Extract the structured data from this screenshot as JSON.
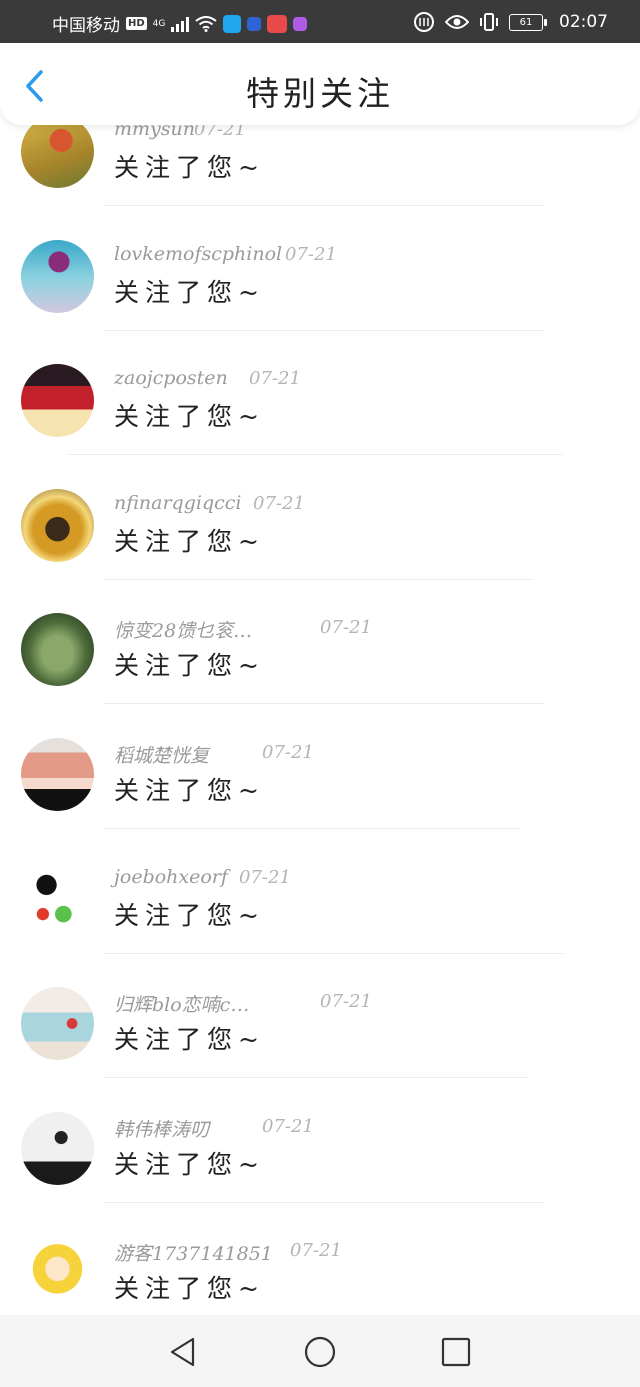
{
  "status_bar": {
    "carrier": "中国移动",
    "hd": "HD",
    "network": "4G",
    "battery": "61",
    "time": "02:07"
  },
  "header": {
    "title": "特别关注",
    "back_icon": "chevron-left-icon"
  },
  "colors": {
    "accent": "#2b9bea",
    "name_text": "#9a9a9a",
    "date_text": "#b4b4b4",
    "message_text": "#222222"
  },
  "items": [
    {
      "name": "mmysun",
      "date": "07-21",
      "message": "关注了您~"
    },
    {
      "name": "lovkemofscphinol",
      "date": "07-21",
      "message": "关注了您~"
    },
    {
      "name": "zaojcposten",
      "date": "07-21",
      "message": "关注了您~"
    },
    {
      "name": "nfinarqgiqcci",
      "date": "07-21",
      "message": "关注了您~"
    },
    {
      "name": "惊变28馈乜衮…",
      "date": "07-21",
      "message": "关注了您~"
    },
    {
      "name": "稻城楚恍复",
      "date": "07-21",
      "message": "关注了您~"
    },
    {
      "name": "joebohxeorf",
      "date": "07-21",
      "message": "关注了您~"
    },
    {
      "name": "归辉blo恋喃c…",
      "date": "07-21",
      "message": "关注了您~"
    },
    {
      "name": "韩伟棒涛叨",
      "date": "07-21",
      "message": "关注了您~"
    },
    {
      "name": "游客1737141851",
      "date": "07-21",
      "message": "关注了您~"
    }
  ],
  "nav_bar": {
    "back_icon": "triangle-back-icon",
    "home_icon": "circle-home-icon",
    "recents_icon": "square-recents-icon"
  }
}
